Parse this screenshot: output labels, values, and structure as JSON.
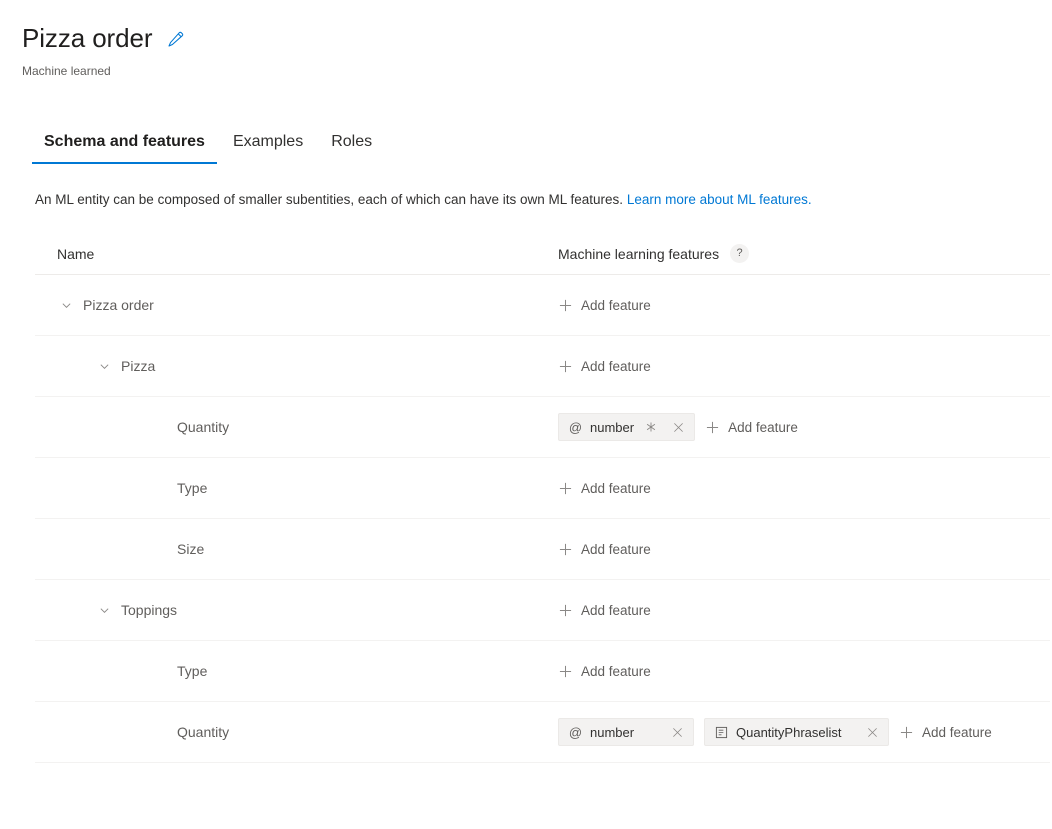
{
  "header": {
    "title": "Pizza order",
    "edit_icon": "pencil-icon",
    "subtitle": "Machine learned"
  },
  "tabs": [
    {
      "label": "Schema and features",
      "active": true
    },
    {
      "label": "Examples",
      "active": false
    },
    {
      "label": "Roles",
      "active": false
    }
  ],
  "description": {
    "text": "An ML entity can be composed of smaller subentities, each of which can have its own ML features. ",
    "link_text": "Learn more about ML features."
  },
  "table": {
    "headers": {
      "name": "Name",
      "features": "Machine learning features",
      "help_icon": "?"
    },
    "add_feature_label": "Add feature",
    "rows": [
      {
        "name": "Pizza order",
        "indent": 0,
        "expandable": true,
        "chips": []
      },
      {
        "name": "Pizza",
        "indent": 1,
        "expandable": true,
        "chips": []
      },
      {
        "name": "Quantity",
        "indent": 2,
        "expandable": false,
        "chips": [
          {
            "icon": "at-sign-icon",
            "icon_glyph": "@",
            "label": "number",
            "required_icon": "asterisk-icon",
            "close_icon": "close-icon"
          }
        ]
      },
      {
        "name": "Type",
        "indent": 2,
        "expandable": false,
        "chips": []
      },
      {
        "name": "Size",
        "indent": 2,
        "expandable": false,
        "chips": []
      },
      {
        "name": "Toppings",
        "indent": 1,
        "expandable": true,
        "chips": []
      },
      {
        "name": "Type",
        "indent": 2,
        "expandable": false,
        "chips": []
      },
      {
        "name": "Quantity",
        "indent": 2,
        "expandable": false,
        "chips": [
          {
            "icon": "at-sign-icon",
            "icon_glyph": "@",
            "label": "number",
            "required_icon": null,
            "close_icon": "close-icon"
          },
          {
            "icon": "phraselist-icon",
            "icon_glyph": "",
            "label": "QuantityPhraselist",
            "required_icon": null,
            "close_icon": "close-icon"
          }
        ]
      }
    ]
  },
  "colors": {
    "accent": "#0078d4",
    "link": "#0078d4",
    "text": "#323130",
    "text_secondary": "#605e5c",
    "chip_bg": "#f3f2f1",
    "row_border": "#f3f2f1"
  }
}
